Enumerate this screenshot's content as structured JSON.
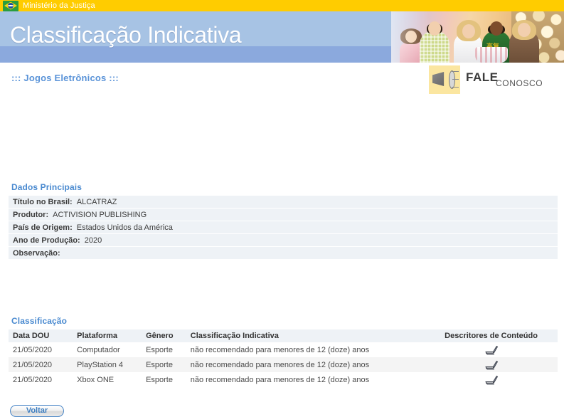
{
  "gov_bar": {
    "title": "Ministério da Justiça",
    "flag_icon": "brazil-flag-icon"
  },
  "masthead": {
    "title": "Classificação Indicativa",
    "banner_text": "高复"
  },
  "subnav": {
    "label": "::: Jogos Eletrônicos :::"
  },
  "fale_conosco": {
    "icon": "megaphone-icon",
    "primary": "FALE",
    "secondary": "CONOSCO"
  },
  "sections": {
    "dados_principais": {
      "title": "Dados Principais",
      "rows": [
        {
          "label": "Título no Brasil:",
          "value": "ALCATRAZ"
        },
        {
          "label": "Produtor:",
          "value": "ACTIVISION PUBLISHING"
        },
        {
          "label": "País de Origem:",
          "value": "Estados Unidos da América"
        },
        {
          "label": "Ano de Produção:",
          "value": "2020"
        },
        {
          "label": "Observação:",
          "value": ""
        }
      ]
    },
    "classificacao": {
      "title": "Classificação",
      "columns": [
        "Data DOU",
        "Plataforma",
        "Gênero",
        "Classificação Indicativa",
        "Descritores de Conteúdo"
      ],
      "rows": [
        {
          "data_dou": "21/05/2020",
          "plataforma": "Computador",
          "genero": "Esporte",
          "classificacao": "não recomendado para menores de 12 (doze) anos",
          "descritor_icon": "signature-pen-icon"
        },
        {
          "data_dou": "21/05/2020",
          "plataforma": "PlayStation 4",
          "genero": "Esporte",
          "classificacao": "não recomendado para menores de 12 (doze) anos",
          "descritor_icon": "signature-pen-icon"
        },
        {
          "data_dou": "21/05/2020",
          "plataforma": "Xbox ONE",
          "genero": "Esporte",
          "classificacao": "não recomendado para menores de 12 (doze) anos",
          "descritor_icon": "signature-pen-icon"
        }
      ]
    }
  },
  "footer": {
    "back_button": "Voltar"
  },
  "colors": {
    "gov_bar": "#ffcc00",
    "masthead": "#a7c3e4",
    "masthead_strip": "#8ba9dd",
    "heading_blue": "#4a8ad0",
    "link_blue": "#5a93d8",
    "rating_purple": "#9b2d8e",
    "row_stripe": "#eef2f6"
  }
}
